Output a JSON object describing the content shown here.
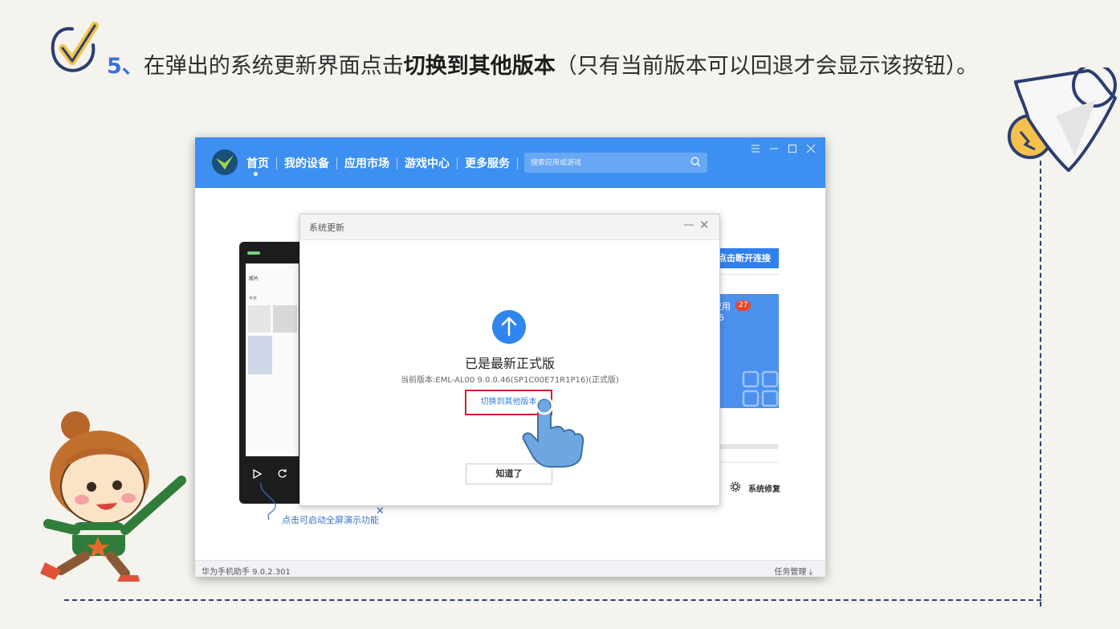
{
  "heading": {
    "step_number": "5、",
    "text_before": "在弹出的系统更新界面点击",
    "bold_text": "切换到其他版本",
    "text_after": "（只有当前版本可以回退才会显示该按钮）。"
  },
  "app": {
    "nav": [
      "首页",
      "我的设备",
      "应用市场",
      "游戏中心",
      "更多服务"
    ],
    "search_placeholder": "搜索应用或游戏",
    "disconnect_label": "点击断开连接",
    "apps_label": "应用",
    "apps_badge": "27",
    "apps_sub": "46",
    "repair_label": "系统修复",
    "hint_text": "点击可启动全屏演示功能",
    "version_text": "华为手机助手 9.0.2.301",
    "task_manager": "任务管理",
    "phone_app_title": "照片",
    "phone_app_sub": "今天"
  },
  "dialog": {
    "title": "系统更新",
    "message": "已是最新正式版",
    "current_version": "当前版本:EML-AL00 9.0.0.46(SP1C00E71R1P16)(正式版)",
    "switch_label": "切换到其他版本",
    "ok_label": "知道了"
  },
  "colors": {
    "accent_blue": "#3d8ff1",
    "highlight_red": "#d21f2d",
    "heading_number": "#3a70d8"
  }
}
